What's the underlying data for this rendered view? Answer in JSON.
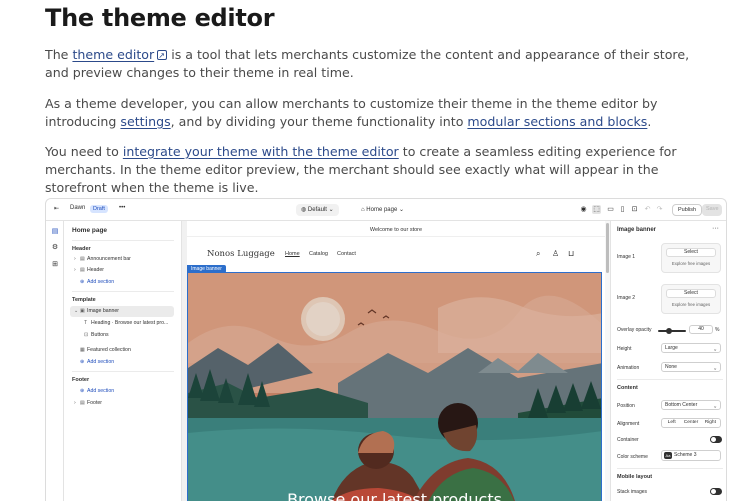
{
  "title": "The theme editor",
  "p1": {
    "before": "The ",
    "link": "theme editor",
    "after": " is a tool that lets merchants customize the content and appearance of their store, and preview changes to their theme in real time."
  },
  "p2": {
    "before": "As a theme developer, you can allow merchants to customize their theme in the theme editor by introducing ",
    "link1": "settings",
    "middle": ", and by dividing your theme functionality into ",
    "link2": "modular sections and blocks",
    "after": "."
  },
  "p3": {
    "before": "You need to ",
    "link": "integrate your theme with the theme editor",
    "after": " to create a seamless editing experience for merchants. In the theme editor preview, the merchant should see exactly what will appear in the storefront when the theme is live."
  },
  "colors": {
    "link": "#2c4a8a",
    "accent": "#2c6ecb",
    "draft_bg": "#d6e4ff"
  },
  "editor": {
    "topbar": {
      "exit_icon": "exit-icon",
      "theme_name": "Dawn",
      "status": "Draft",
      "more": "•••",
      "theme_select": "Default",
      "page_select": "Home page",
      "publish": "Publish",
      "save": "Save"
    },
    "sidebar": {
      "title": "Home page",
      "header_group": "Header",
      "announcement_bar": "Announcement bar",
      "header": "Header",
      "add_section_1": "Add section",
      "template_group": "Template",
      "image_banner": "Image banner",
      "heading_block": "Heading · Browse our latest pro...",
      "buttons_block": "Buttons",
      "featured_collection": "Featured collection",
      "add_section_2": "Add section",
      "footer_group": "Footer",
      "add_section_3": "Add section",
      "footer": "Footer"
    },
    "preview": {
      "announcement": "Welcome to our store",
      "logo": "Nonos Luggage",
      "nav": [
        "Home",
        "Catalog",
        "Contact"
      ],
      "banner_tag": "Image banner",
      "banner_heading": "Browse our latest products"
    },
    "settings": {
      "title": "Image banner",
      "image1_label": "Image 1",
      "image2_label": "Image 2",
      "select": "Select",
      "explore": "Explore free images",
      "overlay_label": "Overlay opacity",
      "overlay_value": "40",
      "overlay_unit": "%",
      "overlay_fraction": 0.4,
      "height_label": "Height",
      "height_value": "Large",
      "animation_label": "Animation",
      "animation_value": "None",
      "content_group": "Content",
      "position_label": "Position",
      "position_value": "Bottom Center",
      "alignment_label": "Alignment",
      "alignment_options": [
        "Left",
        "Center",
        "Right"
      ],
      "container_label": "Container",
      "color_scheme_label": "Color scheme",
      "color_scheme_value": "Scheme 3",
      "color_scheme_chip": "Aa",
      "mobile_group": "Mobile layout",
      "stack_label": "Stack images"
    }
  }
}
